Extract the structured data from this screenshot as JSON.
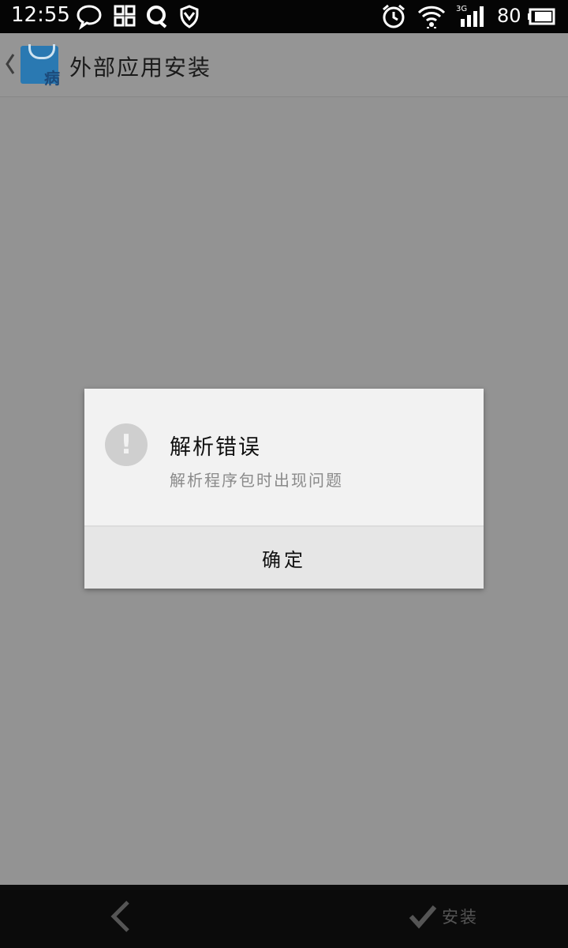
{
  "status_bar": {
    "time": "12:55",
    "network": "3G",
    "battery_level": "80",
    "icons": [
      "chat-bubble-icon",
      "grid-icon",
      "qq-icon",
      "shield-icon",
      "alarm-icon",
      "wifi-icon",
      "signal-icon",
      "battery-icon"
    ]
  },
  "title_bar": {
    "title": "外部应用安装",
    "app_icon_glyph": "病"
  },
  "dialog": {
    "title": "解析错误",
    "message": "解析程序包时出现问题",
    "icon_glyph": "!",
    "ok_label": "确定"
  },
  "bottom_bar": {
    "install_label": "安装"
  },
  "colors": {
    "overlay_background": "#939393",
    "status_bar": "#050505",
    "bottom_bar": "#0b0b0b",
    "dialog_background": "#f2f2f2",
    "button_background": "#e6e6e6",
    "app_icon_blue": "#2a79b2"
  }
}
